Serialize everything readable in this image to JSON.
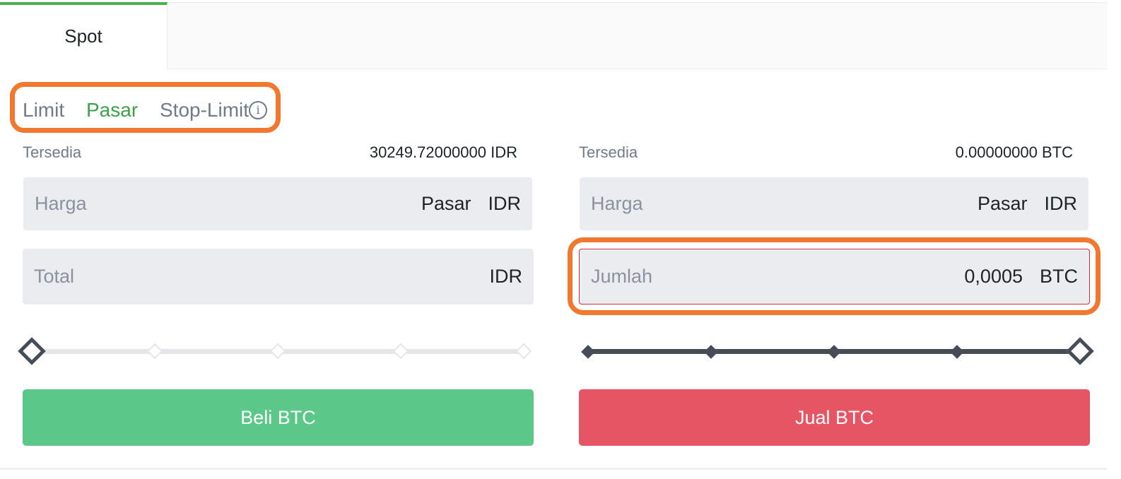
{
  "tabs": {
    "spot": "Spot"
  },
  "order_types": {
    "limit": "Limit",
    "market": "Pasar",
    "stop_limit": "Stop-Limit",
    "active": "Pasar",
    "info_glyph": "i"
  },
  "buy": {
    "available_label": "Tersedia",
    "available_value": "30249.72000000 IDR",
    "price_label": "Harga",
    "price_value": "Pasar",
    "price_unit": "IDR",
    "total_label": "Total",
    "total_unit": "IDR",
    "slider_percent": 0,
    "button_label": "Beli BTC"
  },
  "sell": {
    "available_label": "Tersedia",
    "available_value": "0.00000000 BTC",
    "price_label": "Harga",
    "price_value": "Pasar",
    "price_unit": "IDR",
    "amount_label": "Jumlah",
    "amount_value": "0,0005",
    "amount_unit": "BTC",
    "slider_percent": 100,
    "button_label": "Jual BTC"
  },
  "colors": {
    "accent_green": "#3ea04a",
    "buy_button": "#5bc788",
    "sell_button": "#e55563",
    "highlight": "#f0782f"
  }
}
